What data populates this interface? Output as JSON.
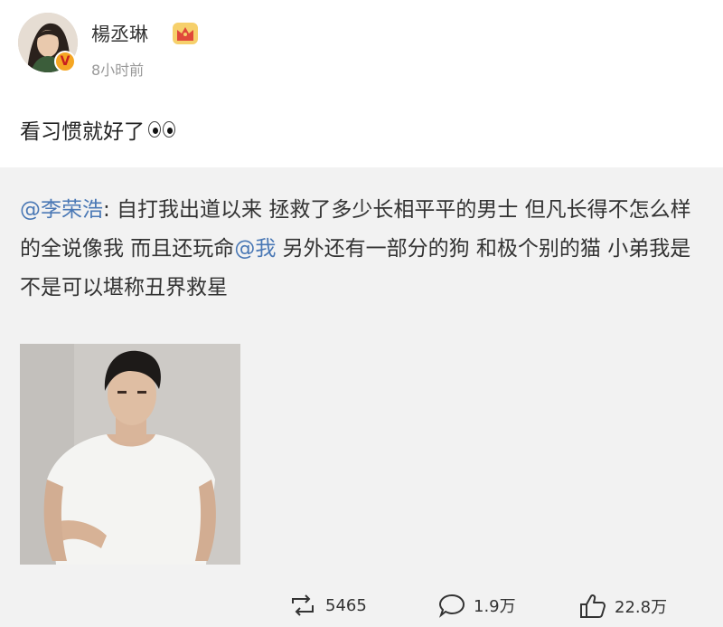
{
  "author": {
    "name": "楊丞琳",
    "time": "8小时前",
    "verified_icon": "verified-v-badge-icon",
    "vip_icon": "crown-icon"
  },
  "post": {
    "text": "看习惯就好了",
    "emoji": "eyes-emoji-icon"
  },
  "repost": {
    "mention": "@李荣浩",
    "text_part1": ": 自打我出道以来 拯救了多少长相平平的男士 但凡长得不怎么样的全说像我 而且还玩命",
    "mention2": "@我",
    "text_part2": " 另外还有一部分的狗 和极个别的猫 小弟我是不是可以堪称丑界救星"
  },
  "actions": {
    "repost_count": "5465",
    "comment_count": "1.9万",
    "like_count": "22.8万"
  },
  "colors": {
    "mention": "#4a78b5",
    "background": "#f2f2f2",
    "card": "#ffffff",
    "badge": "#f5a623"
  }
}
